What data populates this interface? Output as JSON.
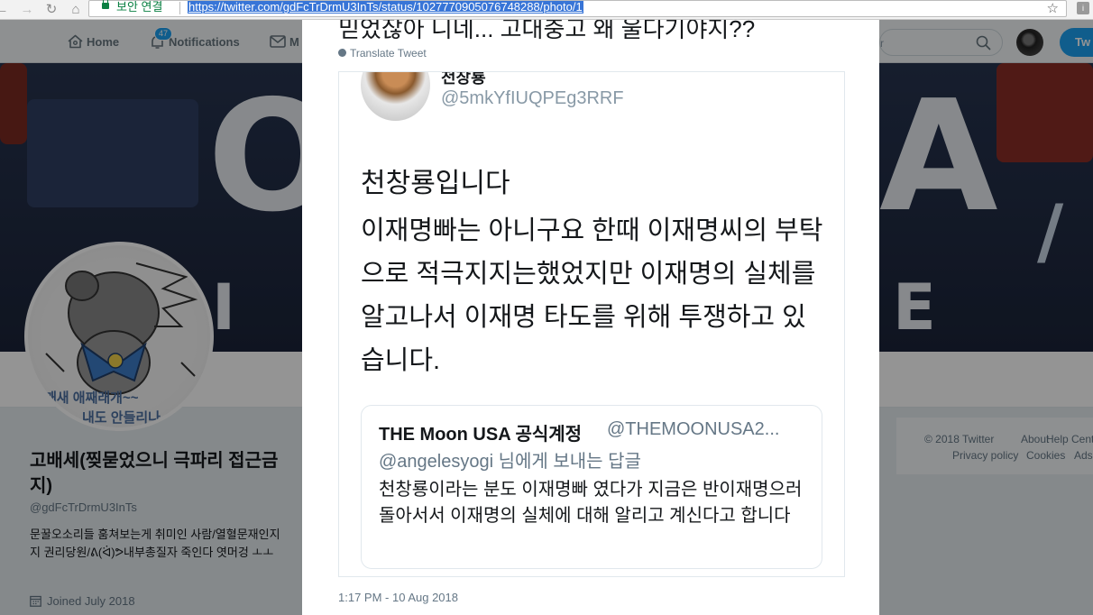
{
  "browser": {
    "secure_label": "보안 연결",
    "url": "https://twitter.com/gdFcTrDrmU3InTs/status/1027770905076748288/photo/1"
  },
  "nav": {
    "home": "Home",
    "notifications": "Notifications",
    "messages": "M",
    "notification_count": "47",
    "search_placeholder": "r",
    "tweet_button": "Tw"
  },
  "profile": {
    "name": "고배세(찢묻었으니 극파리 접근금지)",
    "handle": "@gdFcTrDrmU3InTs",
    "bio": "문꿀오소리들 훔쳐보는게 취미인 사람/열혈문재인지지 권리당원/ᕕ(ᐛ)ᕗ내부총질자 죽인다 엿머겅 ㅗㅗ",
    "joined": "Joined July 2018",
    "avatar_caption_1": "깨새 애째래개~~",
    "avatar_caption_2": "내도 안들리나"
  },
  "footer": {
    "copyright": "© 2018 Twitter",
    "about": "About",
    "help": "Help Cent",
    "privacy": "Privacy policy",
    "cookies": "Cookies",
    "ads": "Ads"
  },
  "tweet": {
    "previous_text": "믿었잖아 니네... 고대충고 왜 울다기야지??",
    "translate_label": "Translate Tweet",
    "timestamp": "1:17 PM - 10 Aug 2018",
    "card": {
      "author_name": "천창룡",
      "author_handle": "@5mkYfIUQPEg3RRF",
      "lead": "천창룡입니다",
      "body": "이재명빠는 아니구요 한때 이재명씨의 부탁으로 적극지지는했었지만 이재명의 실체를 알고나서 이재명 타도를 위해 투쟁하고 있습니다.",
      "quote": {
        "name": "THE Moon USA 공식계정",
        "handle": "@THEMOONUSA2...",
        "reply_to": "@angelesyogi 님에게 보내는 답글",
        "body": "천창룡이라는 분도 이재명빠 였다가 지금은 반이재명으러 돌아서서 이재명의 실체에 대해 알리고 계신다고 합니다"
      }
    }
  },
  "colors": {
    "twitter_blue": "#1da1f2",
    "secure_green": "#0b8043",
    "url_highlight": "#3875d7"
  },
  "icons": {
    "back": "back-arrow-icon",
    "forward": "forward-arrow-icon",
    "reload": "reload-icon",
    "home": "home-icon",
    "lock": "lock-icon",
    "star": "star-icon",
    "bell": "bell-icon",
    "envelope": "envelope-icon",
    "search": "search-icon",
    "calendar": "calendar-icon",
    "globe": "globe-icon"
  }
}
